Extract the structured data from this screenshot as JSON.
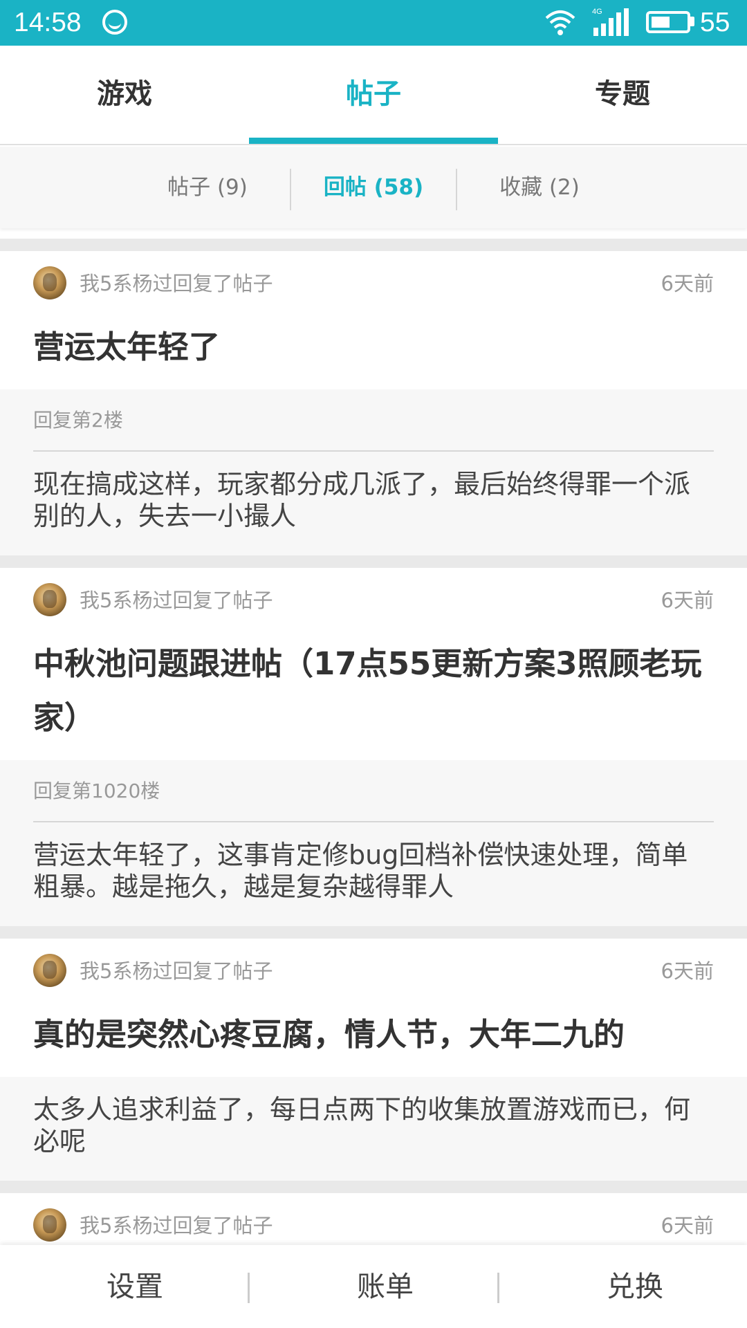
{
  "status_bar": {
    "time": "14:58",
    "network": "4G",
    "battery_level": "55",
    "battery_fraction": 0.55,
    "bg_color": "#1ab3c5"
  },
  "main_tabs": [
    {
      "label": "游戏",
      "active": false
    },
    {
      "label": "帖子",
      "active": true
    },
    {
      "label": "专题",
      "active": false
    }
  ],
  "sub_tabs": [
    {
      "label": "帖子 (9)",
      "active": false
    },
    {
      "label": "回帖 (58)",
      "active": true
    },
    {
      "label": "收藏 (2)",
      "active": false
    }
  ],
  "posts": [
    {
      "user_action": "我5系杨过回复了帖子",
      "time": "6天前",
      "title": "营运太年轻了",
      "reply_floor": "回复第2楼",
      "reply_text": "现在搞成这样，玩家都分成几派了，最后始终得罪一个派别的人，失去一小撮人"
    },
    {
      "user_action": "我5系杨过回复了帖子",
      "time": "6天前",
      "title": "中秋池问题跟进帖（17点55更新方案3照顾老玩家）",
      "reply_floor": "回复第1020楼",
      "reply_text": "营运太年轻了，这事肯定修bug回档补偿快速处理，简单粗暴。越是拖久，越是复杂越得罪人"
    },
    {
      "user_action": "我5系杨过回复了帖子",
      "time": "6天前",
      "title": "真的是突然心疼豆腐，情人节，大年二九的",
      "reply_floor": "",
      "reply_text": "太多人追求利益了，每日点两下的收集放置游戏而已，何必呢"
    },
    {
      "user_action": "我5系杨过回复了帖子",
      "time": "6天前",
      "title": "",
      "reply_floor": "",
      "reply_text": ""
    }
  ],
  "bottom_bar": {
    "settings": "设置",
    "bill": "账单",
    "exchange": "兑换"
  },
  "colors": {
    "accent": "#1ab3c5",
    "separator": "#e9e9e9",
    "reply_bg": "#f7f7f7"
  }
}
